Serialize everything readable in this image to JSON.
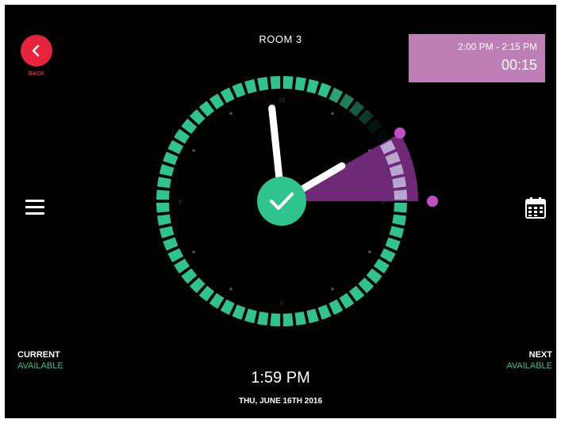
{
  "header": {
    "back_label": "BACK",
    "room_name": "ROOM 3"
  },
  "booking_panel": {
    "time_range": "2:00 PM - 2:15 PM",
    "countdown": "00:15"
  },
  "clock": {
    "current_hour": 13,
    "current_minute": 59,
    "booking_start_minute": 0,
    "booking_end_minute": 15,
    "booking_start_hour": 14,
    "hour_labels": [
      "12",
      "3",
      "6",
      "9"
    ],
    "status": "available"
  },
  "status": {
    "current_heading": "CURRENT",
    "current_value": "AVAILABLE",
    "next_heading": "NEXT",
    "next_value": "AVAILABLE"
  },
  "footer": {
    "time": "1:59 PM",
    "date": "THU, JUNE 16TH 2016"
  },
  "icons": {
    "back": "chevron-left-icon",
    "menu": "hamburger-menu-icon",
    "calendar": "calendar-icon",
    "confirm": "checkmark-icon"
  },
  "colors": {
    "background": "#000000",
    "available": "#2fc48f",
    "booking": "#6e2a76",
    "booking_panel": "#bd7fb6",
    "back_button": "#e8243c",
    "handle": "#c24fc8"
  }
}
